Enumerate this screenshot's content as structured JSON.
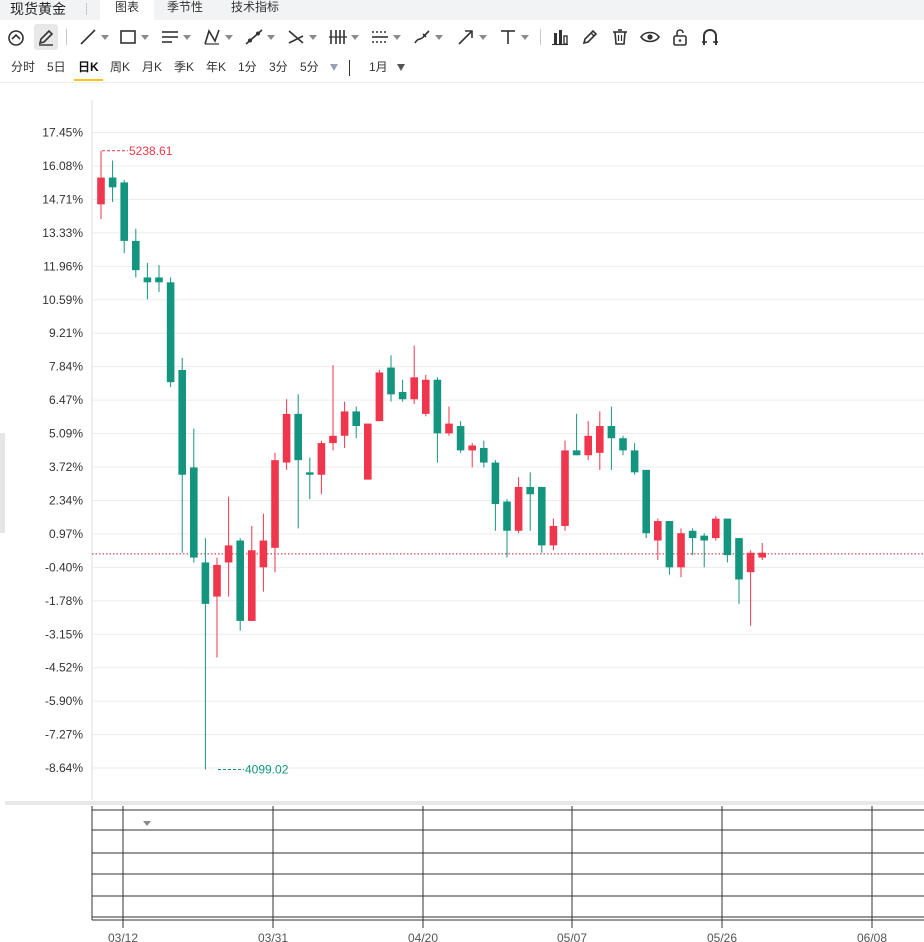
{
  "header": {
    "title": "现货黄金",
    "tabs": [
      {
        "label": "图表",
        "active": true
      },
      {
        "label": "季节性",
        "active": false
      },
      {
        "label": "技术指标",
        "active": false
      }
    ]
  },
  "toolbar": {
    "tools": [
      {
        "icon": "magnet-icon",
        "caret": false
      },
      {
        "icon": "pencil-icon",
        "caret": false,
        "selected": true
      },
      {
        "icon": "line-icon",
        "caret": true
      },
      {
        "icon": "rectangle-icon",
        "caret": true
      },
      {
        "icon": "parallel-lines-icon",
        "caret": true
      },
      {
        "icon": "zigzag-pattern-icon",
        "caret": true
      },
      {
        "icon": "ray-line-icon",
        "caret": true
      },
      {
        "icon": "cross-lines-icon",
        "caret": true
      },
      {
        "icon": "fibonacci-bars-icon",
        "caret": true
      },
      {
        "icon": "dotted-lines-icon",
        "caret": true
      },
      {
        "icon": "brush-icon",
        "caret": true
      },
      {
        "icon": "arrow-icon",
        "caret": true
      },
      {
        "icon": "text-tool-icon",
        "caret": true
      },
      {
        "icon": "measure-icon",
        "caret": false
      },
      {
        "icon": "edit-icon",
        "caret": false
      },
      {
        "icon": "trash-icon",
        "caret": false
      },
      {
        "icon": "eye-icon",
        "caret": false
      },
      {
        "icon": "unlock-icon",
        "caret": false
      },
      {
        "icon": "magnet-u-icon",
        "caret": false
      }
    ]
  },
  "periods": {
    "items": [
      {
        "label": "分时",
        "active": false
      },
      {
        "label": "5日",
        "active": false
      },
      {
        "label": "日K",
        "active": true
      },
      {
        "label": "周K",
        "active": false
      },
      {
        "label": "月K",
        "active": false
      },
      {
        "label": "季K",
        "active": false
      },
      {
        "label": "年K",
        "active": false
      },
      {
        "label": "1分",
        "active": false
      },
      {
        "label": "3分",
        "active": false
      },
      {
        "label": "5分",
        "active": false
      }
    ],
    "range_label": "1月"
  },
  "colors": {
    "up": "#f0364c",
    "down": "#14957f",
    "grid": "#ececec",
    "ref_line": "#c8242f"
  },
  "chart_data": {
    "type": "candlestick",
    "y_unit": "percent change",
    "y_ticks": [
      "17.45%",
      "16.08%",
      "14.71%",
      "13.33%",
      "11.96%",
      "10.59%",
      "9.21%",
      "7.84%",
      "6.47%",
      "5.09%",
      "3.72%",
      "2.34%",
      "0.97%",
      "-0.40%",
      "-1.78%",
      "-3.15%",
      "-4.52%",
      "-5.90%",
      "-7.27%",
      "-8.64%"
    ],
    "ylim": [
      -9.8,
      19.0
    ],
    "x_ticks": [
      "03/12",
      "03/31",
      "04/20",
      "05/07",
      "05/26",
      "06/08"
    ],
    "reference_line_pct": 0.15,
    "high_annotation": {
      "label": "5238.61",
      "candle": 0,
      "pct": 16.7
    },
    "low_annotation": {
      "label": "4099.02",
      "candle": 10,
      "pct": -8.7
    },
    "candles": [
      {
        "o": 14.5,
        "c": 15.6,
        "h": 16.7,
        "l": 13.9
      },
      {
        "o": 15.6,
        "c": 15.2,
        "h": 16.3,
        "l": 14.6
      },
      {
        "o": 15.4,
        "c": 13.0,
        "h": 15.5,
        "l": 12.5
      },
      {
        "o": 13.0,
        "c": 11.8,
        "h": 13.5,
        "l": 11.5
      },
      {
        "o": 11.5,
        "c": 11.3,
        "h": 12.1,
        "l": 10.6
      },
      {
        "o": 11.5,
        "c": 11.3,
        "h": 12.0,
        "l": 10.9
      },
      {
        "o": 11.3,
        "c": 7.2,
        "h": 11.5,
        "l": 7.0
      },
      {
        "o": 7.7,
        "c": 3.4,
        "h": 8.2,
        "l": 0.2
      },
      {
        "o": 3.7,
        "c": 0.0,
        "h": 5.3,
        "l": -0.2
      },
      {
        "o": -0.2,
        "c": -1.9,
        "h": 0.8,
        "l": -8.7
      },
      {
        "o": -1.6,
        "c": -0.3,
        "h": 0.0,
        "l": -4.1
      },
      {
        "o": -0.2,
        "c": 0.5,
        "h": 2.5,
        "l": -1.6
      },
      {
        "o": 0.7,
        "c": -2.6,
        "h": 0.8,
        "l": -3.0
      },
      {
        "o": -2.6,
        "c": 0.3,
        "h": 1.3,
        "l": -2.6
      },
      {
        "o": -0.4,
        "c": 0.7,
        "h": 1.8,
        "l": -1.4
      },
      {
        "o": 0.4,
        "c": 4.0,
        "h": 4.3,
        "l": -0.6
      },
      {
        "o": 3.9,
        "c": 5.9,
        "h": 6.5,
        "l": 3.6
      },
      {
        "o": 5.9,
        "c": 4.0,
        "h": 6.7,
        "l": 1.2
      },
      {
        "o": 3.5,
        "c": 3.4,
        "h": 4.1,
        "l": 2.4
      },
      {
        "o": 3.4,
        "c": 4.7,
        "h": 4.8,
        "l": 2.6
      },
      {
        "o": 4.7,
        "c": 5.0,
        "h": 7.9,
        "l": 4.4
      },
      {
        "o": 5.0,
        "c": 6.0,
        "h": 6.4,
        "l": 4.5
      },
      {
        "o": 6.0,
        "c": 5.4,
        "h": 6.2,
        "l": 4.9
      },
      {
        "o": 3.2,
        "c": 5.5,
        "h": 5.5,
        "l": 3.2
      },
      {
        "o": 5.6,
        "c": 7.6,
        "h": 7.7,
        "l": 5.6
      },
      {
        "o": 7.8,
        "c": 6.7,
        "h": 8.3,
        "l": 6.4
      },
      {
        "o": 6.8,
        "c": 6.5,
        "h": 7.3,
        "l": 6.4
      },
      {
        "o": 6.5,
        "c": 7.4,
        "h": 8.7,
        "l": 6.3
      },
      {
        "o": 5.9,
        "c": 7.3,
        "h": 7.5,
        "l": 5.8
      },
      {
        "o": 7.3,
        "c": 5.1,
        "h": 7.4,
        "l": 3.9
      },
      {
        "o": 5.1,
        "c": 5.5,
        "h": 6.2,
        "l": 5.0
      },
      {
        "o": 5.4,
        "c": 4.4,
        "h": 5.6,
        "l": 4.3
      },
      {
        "o": 4.4,
        "c": 4.6,
        "h": 4.7,
        "l": 3.7
      },
      {
        "o": 4.5,
        "c": 3.9,
        "h": 4.8,
        "l": 3.7
      },
      {
        "o": 3.9,
        "c": 2.2,
        "h": 4.0,
        "l": 1.1
      },
      {
        "o": 2.3,
        "c": 1.1,
        "h": 2.4,
        "l": 0.0
      },
      {
        "o": 1.1,
        "c": 2.9,
        "h": 3.3,
        "l": 1.0
      },
      {
        "o": 2.9,
        "c": 2.6,
        "h": 3.5,
        "l": 1.1
      },
      {
        "o": 2.9,
        "c": 0.5,
        "h": 2.9,
        "l": 0.2
      },
      {
        "o": 0.5,
        "c": 1.3,
        "h": 1.6,
        "l": 0.3
      },
      {
        "o": 1.3,
        "c": 4.4,
        "h": 4.8,
        "l": 1.1
      },
      {
        "o": 4.4,
        "c": 4.2,
        "h": 5.9,
        "l": 4.2
      },
      {
        "o": 4.2,
        "c": 5.0,
        "h": 5.6,
        "l": 4.0
      },
      {
        "o": 4.3,
        "c": 5.4,
        "h": 6.0,
        "l": 3.6
      },
      {
        "o": 5.4,
        "c": 4.9,
        "h": 6.2,
        "l": 3.6
      },
      {
        "o": 4.9,
        "c": 4.4,
        "h": 5.0,
        "l": 4.2
      },
      {
        "o": 4.4,
        "c": 3.5,
        "h": 4.7,
        "l": 3.4
      },
      {
        "o": 3.6,
        "c": 1.0,
        "h": 3.6,
        "l": 0.8
      },
      {
        "o": 0.7,
        "c": 1.5,
        "h": 1.6,
        "l": -0.1
      },
      {
        "o": 1.5,
        "c": -0.4,
        "h": 1.5,
        "l": -0.7
      },
      {
        "o": -0.4,
        "c": 1.0,
        "h": 1.2,
        "l": -0.8
      },
      {
        "o": 1.1,
        "c": 0.8,
        "h": 1.2,
        "l": 0.1
      },
      {
        "o": 0.9,
        "c": 0.7,
        "h": 1.0,
        "l": -0.4
      },
      {
        "o": 0.8,
        "c": 1.6,
        "h": 1.7,
        "l": 0.7
      },
      {
        "o": 1.6,
        "c": 0.1,
        "h": 1.6,
        "l": -0.2
      },
      {
        "o": 0.8,
        "c": -0.9,
        "h": 0.8,
        "l": -1.9
      },
      {
        "o": -0.6,
        "c": 0.2,
        "h": 0.3,
        "l": -2.8
      },
      {
        "o": 0.0,
        "c": 0.2,
        "h": 0.6,
        "l": -0.1
      }
    ]
  }
}
